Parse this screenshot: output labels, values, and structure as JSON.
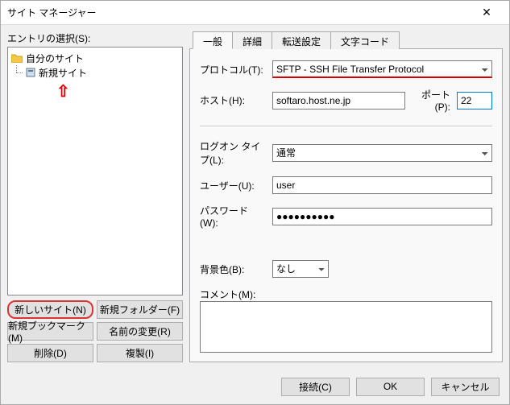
{
  "window": {
    "title": "サイト マネージャー"
  },
  "left": {
    "entry_label": "エントリの選択(S):",
    "tree": {
      "root": "自分のサイト",
      "child": "新規サイト"
    },
    "buttons": {
      "new_site": "新しいサイト(N)",
      "new_folder": "新規フォルダー(F)",
      "new_bookmark": "新規ブックマーク(M)",
      "rename": "名前の変更(R)",
      "delete": "削除(D)",
      "duplicate": "複製(I)"
    }
  },
  "tabs": {
    "general": "一般",
    "detail": "詳細",
    "transfer": "転送設定",
    "charset": "文字コード"
  },
  "form": {
    "protocol_label": "プロトコル(T):",
    "protocol_value": "SFTP - SSH File Transfer Protocol",
    "host_label": "ホスト(H):",
    "host_value": "softaro.host.ne.jp",
    "port_label": "ポート(P):",
    "port_value": "22",
    "logon_label": "ログオン タイプ(L):",
    "logon_value": "通常",
    "user_label": "ユーザー(U):",
    "user_value": "user",
    "pass_label": "パスワード(W):",
    "pass_value": "●●●●●●●●●●",
    "bg_label": "背景色(B):",
    "bg_value": "なし",
    "comment_label": "コメント(M):",
    "comment_value": ""
  },
  "footer": {
    "connect": "接続(C)",
    "ok": "OK",
    "cancel": "キャンセル"
  }
}
